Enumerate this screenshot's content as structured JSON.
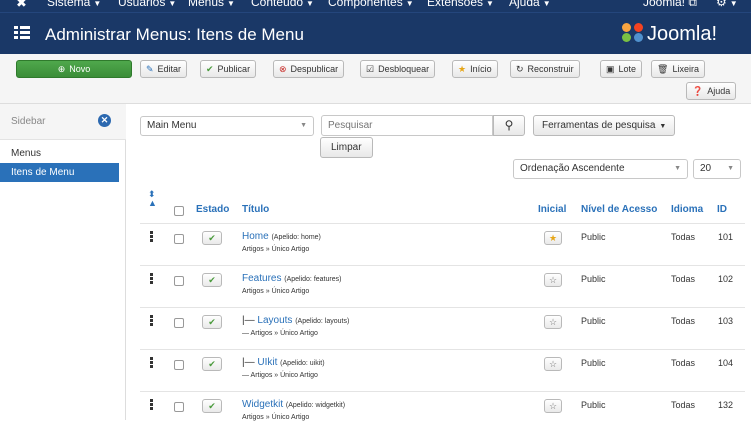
{
  "topnav": {
    "items": [
      "Sistema",
      "Usuários",
      "Menus",
      "Conteúdo",
      "Componentes",
      "Extensões",
      "Ajuda"
    ],
    "site_link": "Joomla! ⧉",
    "settings_icon": "gear-icon"
  },
  "header": {
    "title": "Administrar Menus: Itens de Menu",
    "brand": "Joomla!"
  },
  "toolbar": {
    "new": "Novo",
    "edit": "Editar",
    "publish": "Publicar",
    "unpublish": "Despublicar",
    "unlock": "Desbloquear",
    "home": "Início",
    "rebuild": "Reconstruir",
    "batch": "Lote",
    "trash": "Lixeira",
    "help": "Ajuda"
  },
  "sidebar": {
    "title": "Sidebar",
    "items": [
      {
        "label": "Menus",
        "active": false
      },
      {
        "label": "Itens de Menu",
        "active": true
      }
    ]
  },
  "filters": {
    "menu_select": "Main Menu",
    "search_placeholder": "Pesquisar",
    "search_tools": "Ferramentas de pesquisa",
    "clear": "Limpar",
    "ordering": "Ordenação Ascendente",
    "limit": "20"
  },
  "table": {
    "headers": {
      "status": "Estado",
      "title": "Título",
      "home": "Inicial",
      "access": "Nível de Acesso",
      "language": "Idioma",
      "id": "ID"
    },
    "rows": [
      {
        "title": "Home",
        "alias": "(Apelido: home)",
        "sub": "Artigos » Único Artigo",
        "home": true,
        "access": "Public",
        "language": "Todas",
        "id": "101"
      },
      {
        "title": "Features",
        "alias": "(Apelido: features)",
        "sub": "Artigos » Único Artigo",
        "home": false,
        "access": "Public",
        "language": "Todas",
        "id": "102"
      },
      {
        "prefix": "|— ",
        "title": "Layouts",
        "alias": "(Apelido: layouts)",
        "sub": "— Artigos » Único Artigo",
        "home": false,
        "access": "Public",
        "language": "Todas",
        "id": "103"
      },
      {
        "prefix": "|— ",
        "title": "UIkit",
        "alias": "(Apelido: uikit)",
        "sub": "— Artigos » Único Artigo",
        "home": false,
        "access": "Public",
        "language": "Todas",
        "id": "104"
      },
      {
        "title": "Widgetkit",
        "alias": "(Apelido: widgetkit)",
        "sub": "Artigos » Único Artigo",
        "home": false,
        "access": "Public",
        "language": "Todas",
        "id": "132"
      }
    ]
  },
  "colors": {
    "nav": "#1a3867",
    "accent": "#2a71b9",
    "new_button": "#46a046",
    "published": "#4a9a3c"
  }
}
